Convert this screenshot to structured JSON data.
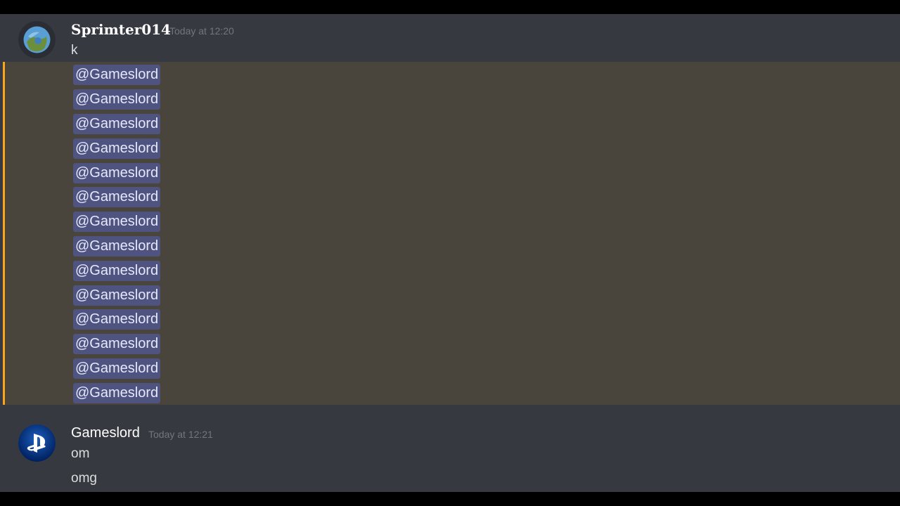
{
  "messages": [
    {
      "username": "Sprimter014",
      "timestamp": "Today at 12:20",
      "lines": [
        "k"
      ],
      "avatar_icon": "blue-planet-avatar-icon"
    },
    {
      "username": "Gameslord",
      "timestamp": "Today at 12:21",
      "lines": [
        "om",
        "omg"
      ],
      "avatar_icon": "playstation-logo-avatar-icon"
    }
  ],
  "mentions": [
    "@Gameslord",
    "@Gameslord",
    "@Gameslord",
    "@Gameslord",
    "@Gameslord",
    "@Gameslord",
    "@Gameslord",
    "@Gameslord",
    "@Gameslord",
    "@Gameslord",
    "@Gameslord",
    "@Gameslord",
    "@Gameslord",
    "@Gameslord"
  ],
  "colors": {
    "background": "#36393f",
    "mention_highlight": "#49443c",
    "mention_bar": "#faa61a",
    "mention_pill": "#4e537f",
    "timestamp": "#72767d"
  }
}
